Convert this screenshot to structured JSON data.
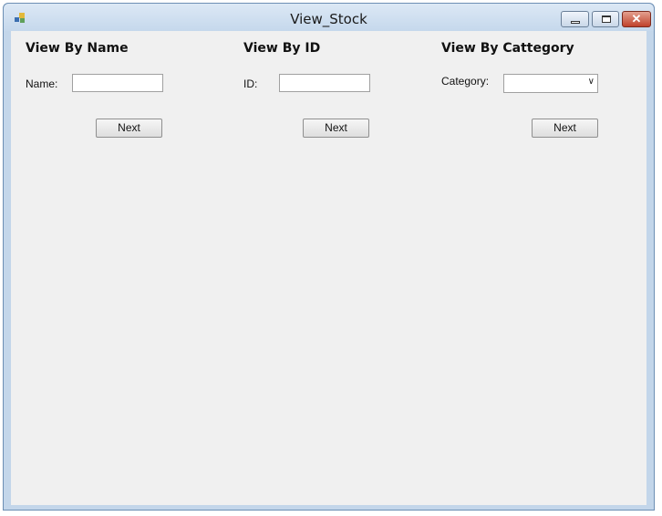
{
  "window": {
    "title": "View_Stock"
  },
  "sections": {
    "by_name": {
      "heading": "View By Name",
      "label": "Name:",
      "value": "",
      "button": "Next"
    },
    "by_id": {
      "heading": "View By ID",
      "label": "ID:",
      "value": "",
      "button": "Next"
    },
    "by_category": {
      "heading": "View By Cattegory",
      "label": "Category:",
      "selected": "",
      "button": "Next"
    }
  },
  "icons": {
    "app": "app-icon",
    "minimize": "minimize-icon",
    "maximize": "maximize-icon",
    "close": "close-icon",
    "dropdown": "chevron-down-icon"
  }
}
